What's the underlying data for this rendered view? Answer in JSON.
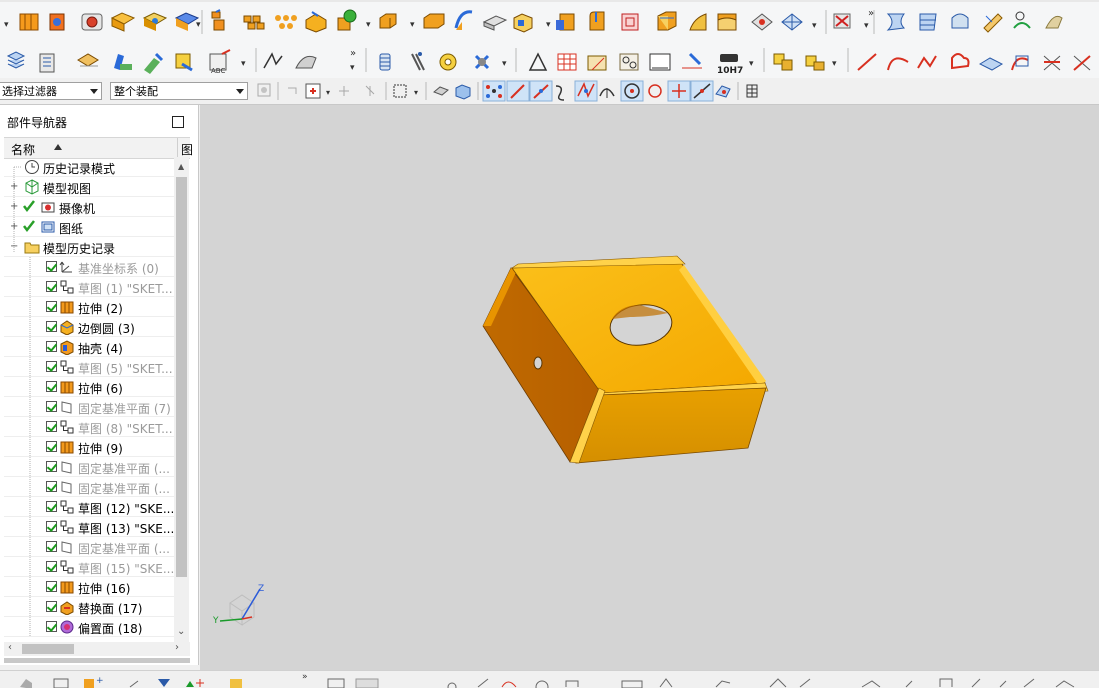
{
  "filters": {
    "selection_filter": "选择过滤器",
    "assembly_scope": "整个装配"
  },
  "toolbar": {
    "row1_icons": [
      "extrude-icon",
      "revolve-icon",
      "hole-icon",
      "boss-icon",
      "pocket-icon",
      "pad-icon",
      "emboss-icon",
      "pattern-feature-icon",
      "combine-icon",
      "datum-point-icon",
      "block-icon",
      "cylinder-icon",
      "sweep-icon",
      "groove-icon",
      "offset-region-icon",
      "shell-icon",
      "trim-body-icon",
      "edge-blend-icon",
      "chamfer-icon",
      "face-blend-icon",
      "delete-face-icon",
      "thicken-icon",
      "extract-geometry-icon",
      "through-curves-icon",
      "studio-surface-icon",
      "n-sided-surface-icon",
      "law-extension-icon",
      "bridge-surface-icon"
    ],
    "row2_icons": [
      "replace-face-icon",
      "synchronous-move-icon",
      "draft-icon",
      "wrap-geometry-icon",
      "text-icon",
      "section-curve-icon",
      "isocline-icon",
      "thread-icon",
      "spring-icon",
      "gear-icon",
      "weld-icon",
      "triangle-icon",
      "table-icon",
      "assembly-icon",
      "sketch-icon",
      "drawing-sheet-icon",
      "dimension-icon",
      "gdt-icon",
      "measure-icon",
      "component-icon",
      "add-component-icon",
      "line-icon",
      "arc-icon",
      "spline-icon",
      "profile-icon",
      "sheetmetal-icon",
      "curve-on-surface-icon",
      "project-curve-icon"
    ],
    "tolerance_label": "10H7",
    "more_marker": "»"
  },
  "navigator": {
    "title": "部件导航器",
    "column_name": "名称",
    "column_picture": "图",
    "nodes": [
      {
        "label": "历史记录模式",
        "icon": "clock-icon",
        "state": "plain"
      },
      {
        "label": "模型视图",
        "icon": "model-views-icon",
        "state": "plain"
      },
      {
        "label": "摄像机",
        "icon": "camera-icon",
        "state": "checked"
      },
      {
        "label": "图纸",
        "icon": "drawing-icon",
        "state": "checked"
      },
      {
        "label": "模型历史记录",
        "icon": "folder-icon",
        "state": "open"
      }
    ],
    "features": [
      {
        "label": "基准坐标系 (0)",
        "icon": "datum-csys-icon",
        "dim": true
      },
      {
        "label": "草图 (1) \"SKET...",
        "icon": "sketch-icon",
        "dim": true
      },
      {
        "label": "拉伸 (2)",
        "icon": "extrude-icon",
        "dim": false
      },
      {
        "label": "边倒圆 (3)",
        "icon": "edge-blend-icon",
        "dim": false
      },
      {
        "label": "抽壳 (4)",
        "icon": "shell-icon",
        "dim": false
      },
      {
        "label": "草图 (5) \"SKET...",
        "icon": "sketch-icon",
        "dim": true
      },
      {
        "label": "拉伸 (6)",
        "icon": "extrude-icon",
        "dim": false
      },
      {
        "label": "固定基准平面 (7)",
        "icon": "datum-plane-icon",
        "dim": true
      },
      {
        "label": "草图 (8) \"SKET...",
        "icon": "sketch-icon",
        "dim": true
      },
      {
        "label": "拉伸 (9)",
        "icon": "extrude-icon",
        "dim": false
      },
      {
        "label": "固定基准平面 (...",
        "icon": "datum-plane-icon",
        "dim": true
      },
      {
        "label": "固定基准平面 (...",
        "icon": "datum-plane-icon",
        "dim": true
      },
      {
        "label": "草图 (12) \"SKE...",
        "icon": "sketch-icon",
        "dim": false
      },
      {
        "label": "草图 (13) \"SKE...",
        "icon": "sketch-icon",
        "dim": false
      },
      {
        "label": "固定基准平面 (...",
        "icon": "datum-plane-icon",
        "dim": true
      },
      {
        "label": "草图 (15) \"SKE...",
        "icon": "sketch-icon",
        "dim": true
      },
      {
        "label": "拉伸 (16)",
        "icon": "extrude-icon",
        "dim": false
      },
      {
        "label": "替换面 (17)",
        "icon": "replace-face-icon",
        "dim": false
      },
      {
        "label": "偏置面 (18)",
        "icon": "offset-face-icon",
        "dim": false
      }
    ]
  },
  "viewport": {
    "background": "#d4d4d4",
    "model_color": "#f5a800",
    "triad": {
      "x": "X",
      "y": "Y",
      "z": "Z"
    }
  }
}
